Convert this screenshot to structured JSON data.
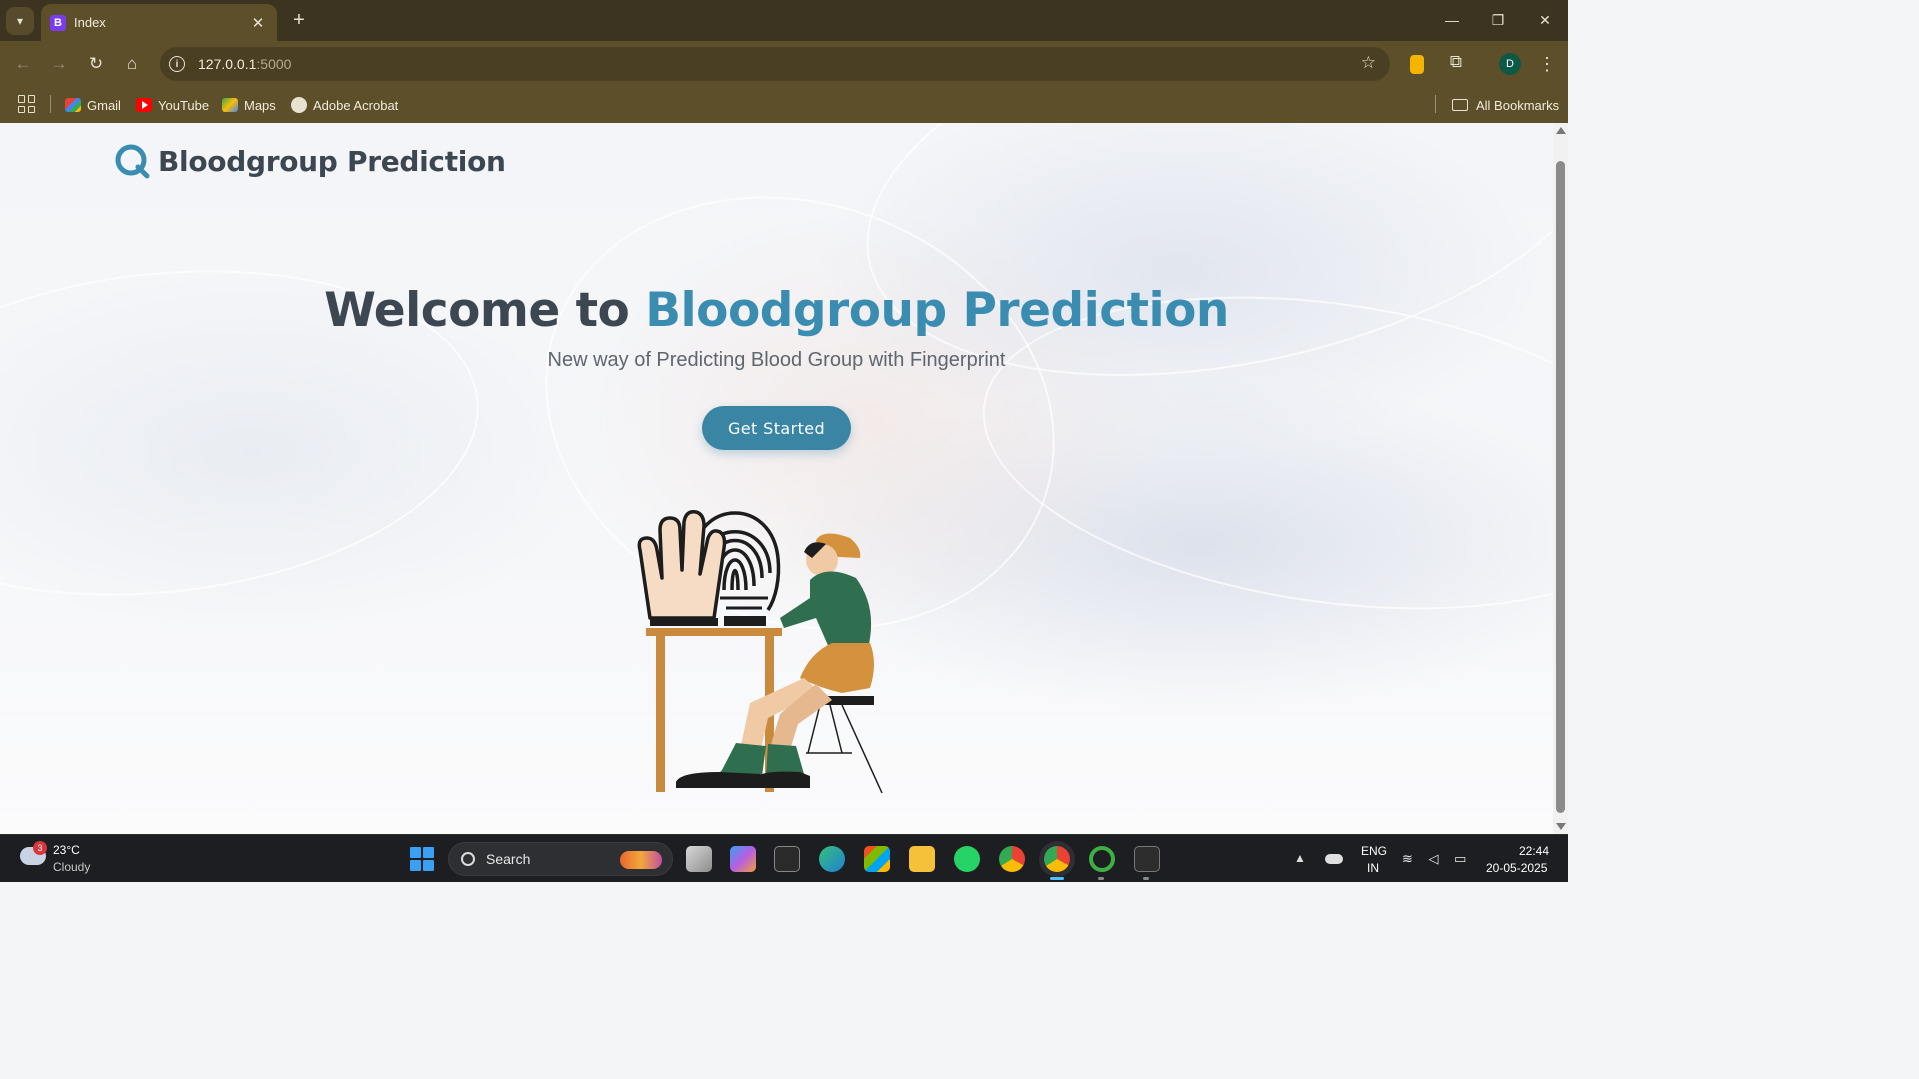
{
  "browser": {
    "tab": {
      "favicon_letter": "B",
      "title": "Index",
      "close": "✕"
    },
    "new_tab": "+",
    "window_controls": {
      "minimize": "—",
      "restore": "❐",
      "close": "✕"
    },
    "address": {
      "host": "127.0.0.1",
      "port": ":5000"
    },
    "profile_initial": "D",
    "bookmarks": [
      {
        "label": "Gmail",
        "icon": "gmail-icon"
      },
      {
        "label": "YouTube",
        "icon": "youtube-icon"
      },
      {
        "label": "Maps",
        "icon": "maps-icon"
      },
      {
        "label": "Adobe Acrobat",
        "icon": "globe-icon"
      }
    ],
    "all_bookmarks": "All Bookmarks"
  },
  "page": {
    "brand": "Bloodgroup Prediction",
    "hero_title_prefix": "Welcome to ",
    "hero_title_accent": "Bloodgroup Prediction",
    "hero_subtitle": "New way of Predicting Blood Group with Fingerprint",
    "cta_label": "Get Started",
    "colors": {
      "accent": "#3a8db0",
      "heading": "#3d4752",
      "button": "#3a84a4"
    }
  },
  "taskbar": {
    "weather": {
      "badge": "3",
      "temp": "23°C",
      "condition": "Cloudy"
    },
    "search_placeholder": "Search",
    "tray": {
      "lang_line1": "ENG",
      "lang_line2": "IN",
      "time": "22:44",
      "date": "20-05-2025"
    }
  }
}
